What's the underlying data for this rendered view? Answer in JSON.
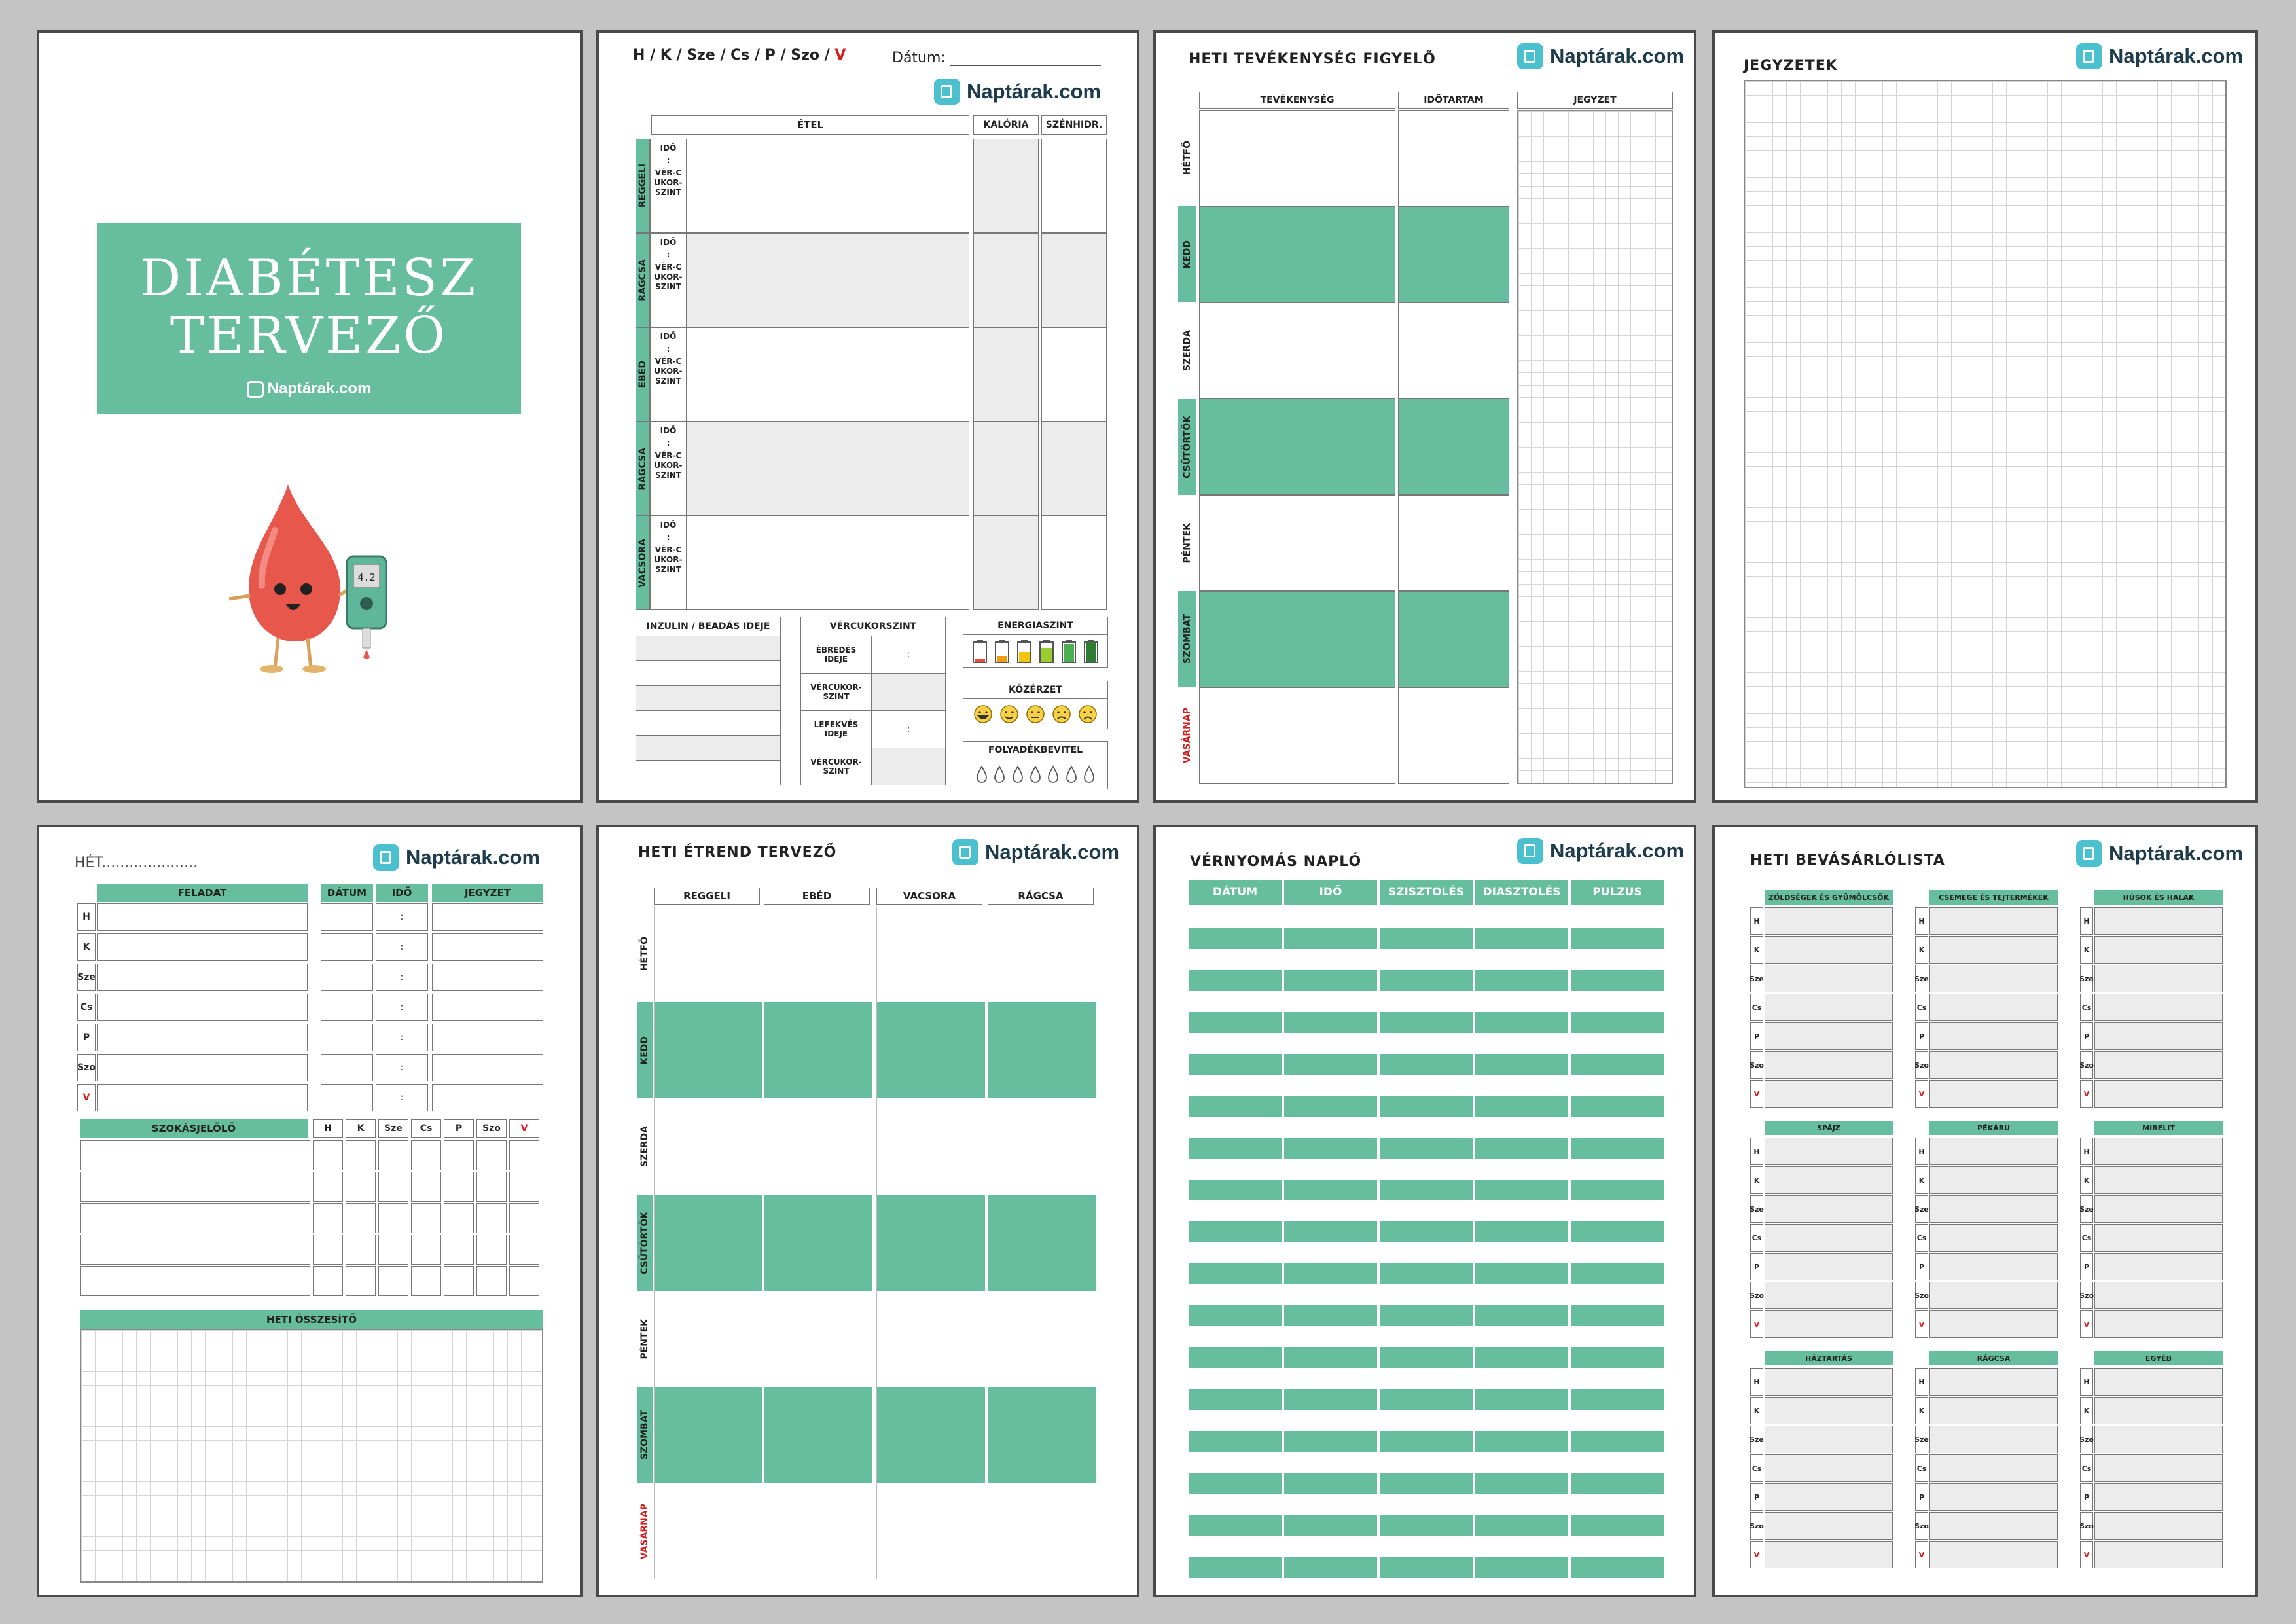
{
  "brand": "Naptárak.com",
  "colors": {
    "accent": "#67be9f",
    "border": "#4a4a4a",
    "background": "#c4c4c4",
    "red": "#d61e1e"
  },
  "cover": {
    "title_line1": "DIABÉTESZ",
    "title_line2": "TERVEZŐ",
    "brand": "Naptárak.com",
    "meter_reading": "4.2"
  },
  "daily": {
    "days": [
      "H",
      "K",
      "Sze",
      "Cs",
      "P",
      "Szo",
      "V"
    ],
    "date_label": "Dátum:",
    "columns": [
      "ÉTEL",
      "KALÓRIA",
      "SZÉNHIDR."
    ],
    "meals": [
      "REGGELI",
      "RÁGCSA",
      "EBÉD",
      "RÁGCSA",
      "VACSORA"
    ],
    "time_label": "IDŐ",
    "colon": ":",
    "sugar_label": "VÉR-CUKOR-SZINT",
    "insulin_header": "INZULIN / BEADÁS IDEJE",
    "sugar_header": "VÉRCUKORSZINT",
    "sugar_rows": [
      "ÉBREDÉS IDEJE",
      "VÉRCUKOR-SZINT",
      "LEFEKVÉS IDEJE",
      "VÉRCUKOR-SZINT"
    ],
    "energy_header": "ENERGIASZINT",
    "mood_header": "KÖZÉRZET",
    "mood_icons": [
      "laugh-face-icon",
      "smile-face-icon",
      "neutral-face-icon",
      "sad-face-icon",
      "cry-face-icon"
    ],
    "fluid_header": "FOLYADÉKBEVITEL",
    "energy_icons": [
      "battery-empty-icon",
      "battery-low-icon",
      "battery-mid-icon",
      "battery-high-icon",
      "battery-full-icon",
      "battery-charging-icon"
    ]
  },
  "activity": {
    "title": "HETI TEVÉKENYSÉG FIGYELŐ",
    "columns": [
      "TEVÉKENYSÉG",
      "IDŐTARTAM",
      "JEGYZET"
    ]
  },
  "weekdays_long": [
    "HÉTFŐ",
    "KEDD",
    "SZERDA",
    "CSÜTÖRTÖK",
    "PÉNTEK",
    "SZOMBAT",
    "VASÁRNAP"
  ],
  "notes": {
    "title": "JEGYZETEK"
  },
  "weekly": {
    "week_label": "HÉT.....................",
    "columns": [
      "FELADAT",
      "DÁTUM",
      "IDŐ",
      "JEGYZET"
    ],
    "habit_header": "SZOKÁSJELÖLŐ",
    "summary_header": "HETI ÖSSZESÍTŐ"
  },
  "meal_plan": {
    "title": "HETI ÉTREND TERVEZŐ",
    "columns": [
      "REGGELI",
      "EBÉD",
      "VACSORA",
      "RÁGCSA"
    ]
  },
  "bp": {
    "title": "VÉRNYOMÁS NAPLÓ",
    "columns": [
      "DÁTUM",
      "IDŐ",
      "SZISZTOLÉS",
      "DIASZTOLÉS",
      "PULZUS"
    ]
  },
  "shopping": {
    "title": "HETI BEVÁSÁRLÓLISTA",
    "categories": [
      "ZÖLDSÉGEK ÉS GYÜMÖLCSÖK",
      "CSEMEGE ÉS TEJTERMÉKEK",
      "HÚSOK ÉS HALAK",
      "SPÁJZ",
      "PÉKÁRU",
      "MIRELIT",
      "HÁZTARTÁS",
      "RÁGCSA",
      "EGYÉB"
    ]
  }
}
